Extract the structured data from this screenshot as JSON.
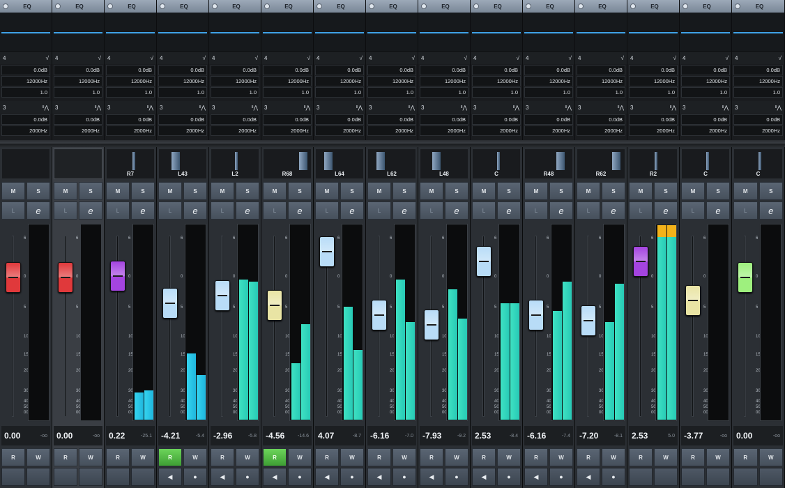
{
  "eq_label": "EQ",
  "eq_band4": {
    "num": "4",
    "gain": "0.0dB",
    "freq": "12000Hz",
    "q": "1.0"
  },
  "eq_band3": {
    "num": "3",
    "gain": "0.0dB",
    "freq": "2000Hz"
  },
  "buttons": {
    "mute": "M",
    "solo": "S",
    "listen": "L",
    "edit": "e",
    "read": "R",
    "write": "W",
    "prev": "◀",
    "rec": "●"
  },
  "fader_scale": [
    "6",
    "0",
    "5",
    "10",
    "15",
    "20",
    "30",
    "40",
    "50",
    "00"
  ],
  "channels": [
    {
      "pan_label": "",
      "pan_value": 0,
      "fader_color": "#e0393b",
      "fader_db": 0.0,
      "volume": "0.00",
      "peak": "-oo",
      "meter_level": [
        0,
        0
      ],
      "meter_color": "teal",
      "read_active": false,
      "transport": false,
      "selected": false
    },
    {
      "pan_label": "",
      "pan_value": 0,
      "fader_color": "#e0393b",
      "fader_db": 0.0,
      "volume": "0.00",
      "peak": "-oo",
      "meter_level": [
        0,
        0
      ],
      "meter_color": "teal",
      "read_active": false,
      "transport": false,
      "selected": true
    },
    {
      "pan_label": "R7",
      "pan_value": 7,
      "fader_color": "#a444e0",
      "fader_db": 0.22,
      "volume": "0.22",
      "peak": "-25.1",
      "meter_level": [
        0.14,
        0.15
      ],
      "meter_color": "cyan",
      "read_active": false,
      "transport": false,
      "selected": false
    },
    {
      "pan_label": "L43",
      "pan_value": -43,
      "fader_color": "#b8dcf7",
      "fader_db": -4.21,
      "volume": "-4.21",
      "peak": "-5.4",
      "meter_level": [
        0.34,
        0.23
      ],
      "meter_color": "cyan",
      "read_active": true,
      "transport": true,
      "selected": false
    },
    {
      "pan_label": "L2",
      "pan_value": -2,
      "fader_color": "#b8dcf7",
      "fader_db": -2.96,
      "volume": "-2.96",
      "peak": "-5.8",
      "meter_level": [
        0.72,
        0.71
      ],
      "meter_color": "teal",
      "read_active": false,
      "transport": true,
      "selected": false
    },
    {
      "pan_label": "R68",
      "pan_value": 68,
      "fader_color": "#e9e4a4",
      "fader_db": -4.56,
      "volume": "-4.56",
      "peak": "-14.6",
      "meter_level": [
        0.29,
        0.49
      ],
      "meter_color": "teal",
      "read_active": true,
      "transport": true,
      "selected": false
    },
    {
      "pan_label": "L64",
      "pan_value": -64,
      "fader_color": "#b8dcf7",
      "fader_db": 4.07,
      "volume": "4.07",
      "peak": "-8.7",
      "meter_level": [
        0.58,
        0.36
      ],
      "meter_color": "teal",
      "read_active": false,
      "transport": true,
      "selected": false
    },
    {
      "pan_label": "L62",
      "pan_value": -62,
      "fader_color": "#b8dcf7",
      "fader_db": -6.16,
      "volume": "-6.16",
      "peak": "-7.0",
      "meter_level": [
        0.72,
        0.5
      ],
      "meter_color": "teal",
      "read_active": false,
      "transport": true,
      "selected": false
    },
    {
      "pan_label": "L48",
      "pan_value": -48,
      "fader_color": "#b8dcf7",
      "fader_db": -7.93,
      "volume": "-7.93",
      "peak": "-9.2",
      "meter_level": [
        0.67,
        0.52
      ],
      "meter_color": "teal",
      "read_active": false,
      "transport": true,
      "selected": false
    },
    {
      "pan_label": "C",
      "pan_value": 0,
      "fader_color": "#b8dcf7",
      "fader_db": 2.53,
      "volume": "2.53",
      "peak": "-8.4",
      "meter_level": [
        0.6,
        0.6
      ],
      "meter_color": "teal",
      "read_active": false,
      "transport": true,
      "selected": false
    },
    {
      "pan_label": "R48",
      "pan_value": 48,
      "fader_color": "#b8dcf7",
      "fader_db": -6.16,
      "volume": "-6.16",
      "peak": "-7.4",
      "meter_level": [
        0.56,
        0.71
      ],
      "meter_color": "teal",
      "read_active": false,
      "transport": true,
      "selected": false
    },
    {
      "pan_label": "R62",
      "pan_value": 62,
      "fader_color": "#b8dcf7",
      "fader_db": -7.2,
      "volume": "-7.20",
      "peak": "-8.1",
      "meter_level": [
        0.5,
        0.7
      ],
      "meter_color": "teal",
      "read_active": false,
      "transport": true,
      "selected": false
    },
    {
      "pan_label": "R2",
      "pan_value": 2,
      "fader_color": "#a444e0",
      "fader_db": 2.53,
      "volume": "2.53",
      "peak": "5.0",
      "meter_level": [
        1.0,
        1.0
      ],
      "meter_color": "teal",
      "clip": true,
      "read_active": false,
      "transport": false,
      "selected": false
    },
    {
      "pan_label": "C",
      "pan_value": 0,
      "fader_color": "#e9e4a4",
      "fader_db": -3.77,
      "volume": "-3.77",
      "peak": "-oo",
      "meter_level": [
        0,
        0
      ],
      "meter_color": "teal",
      "read_active": false,
      "transport": false,
      "selected": false
    },
    {
      "pan_label": "C",
      "pan_value": 0,
      "fader_color": "#9ef07e",
      "fader_db": 0.0,
      "volume": "0.00",
      "peak": "-oo",
      "meter_level": [
        0,
        0
      ],
      "meter_color": "teal",
      "read_active": false,
      "transport": false,
      "selected": false
    }
  ]
}
